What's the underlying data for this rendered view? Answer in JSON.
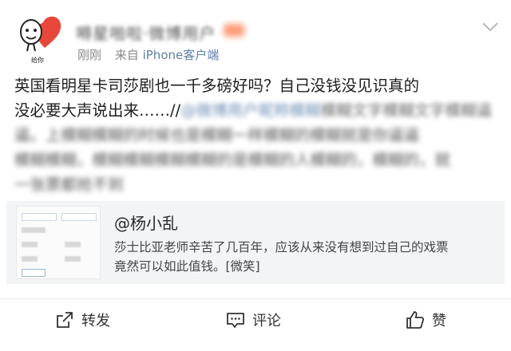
{
  "post": {
    "avatar_caption": "给你",
    "username": "嘚星啪啦·微博用户",
    "meta": {
      "time": "刚刚",
      "source_prefix": "来自",
      "device": "iPhone客户端"
    },
    "text_lines": [
      "英国看明星卡司莎剧也一千多磅好吗？自己没钱没见识真的",
      "没必要大声说出来……//"
    ],
    "mention_blurred": "@微博用户昵称模糊",
    "blurred_lines": [
      "模糊文字模糊文字模糊逼",
      "逼。上模糊模糊的时候也是模糊一样模糊的模糊就是你逼逼",
      "模糊模糊，模糊模糊模糊模糊的是模糊的人模糊的，模糊的，就",
      "一张票都抢不到"
    ],
    "brand_color": "#e8483c",
    "link_color": "#5f7fa8"
  },
  "repost": {
    "name": "@杨小乱",
    "text_lines": [
      "莎士比亚老师辛苦了几百年，应该从来没有想到过自己的戏票",
      "竟然可以如此值钱。[微笑]"
    ]
  },
  "actions": {
    "repost_label": "转发",
    "comment_label": "评论",
    "like_label": "赞"
  }
}
